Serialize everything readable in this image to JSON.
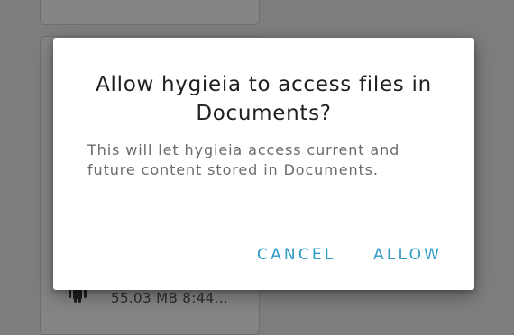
{
  "background": {
    "file_item": {
      "meta": "55.03 MB 8:44...",
      "icon": "android-icon"
    }
  },
  "dialog": {
    "title": "Allow hygieia to access files in Documents?",
    "message": "This will let hygieia access current and future content stored in Documents.",
    "cancel_label": "CANCEL",
    "allow_label": "ALLOW"
  },
  "colors": {
    "accent": "#2f9ac6",
    "scrim": "#7e7e7e",
    "dialog_bg": "#ffffff",
    "title_text": "#202020",
    "message_text": "#6a6a6a"
  }
}
